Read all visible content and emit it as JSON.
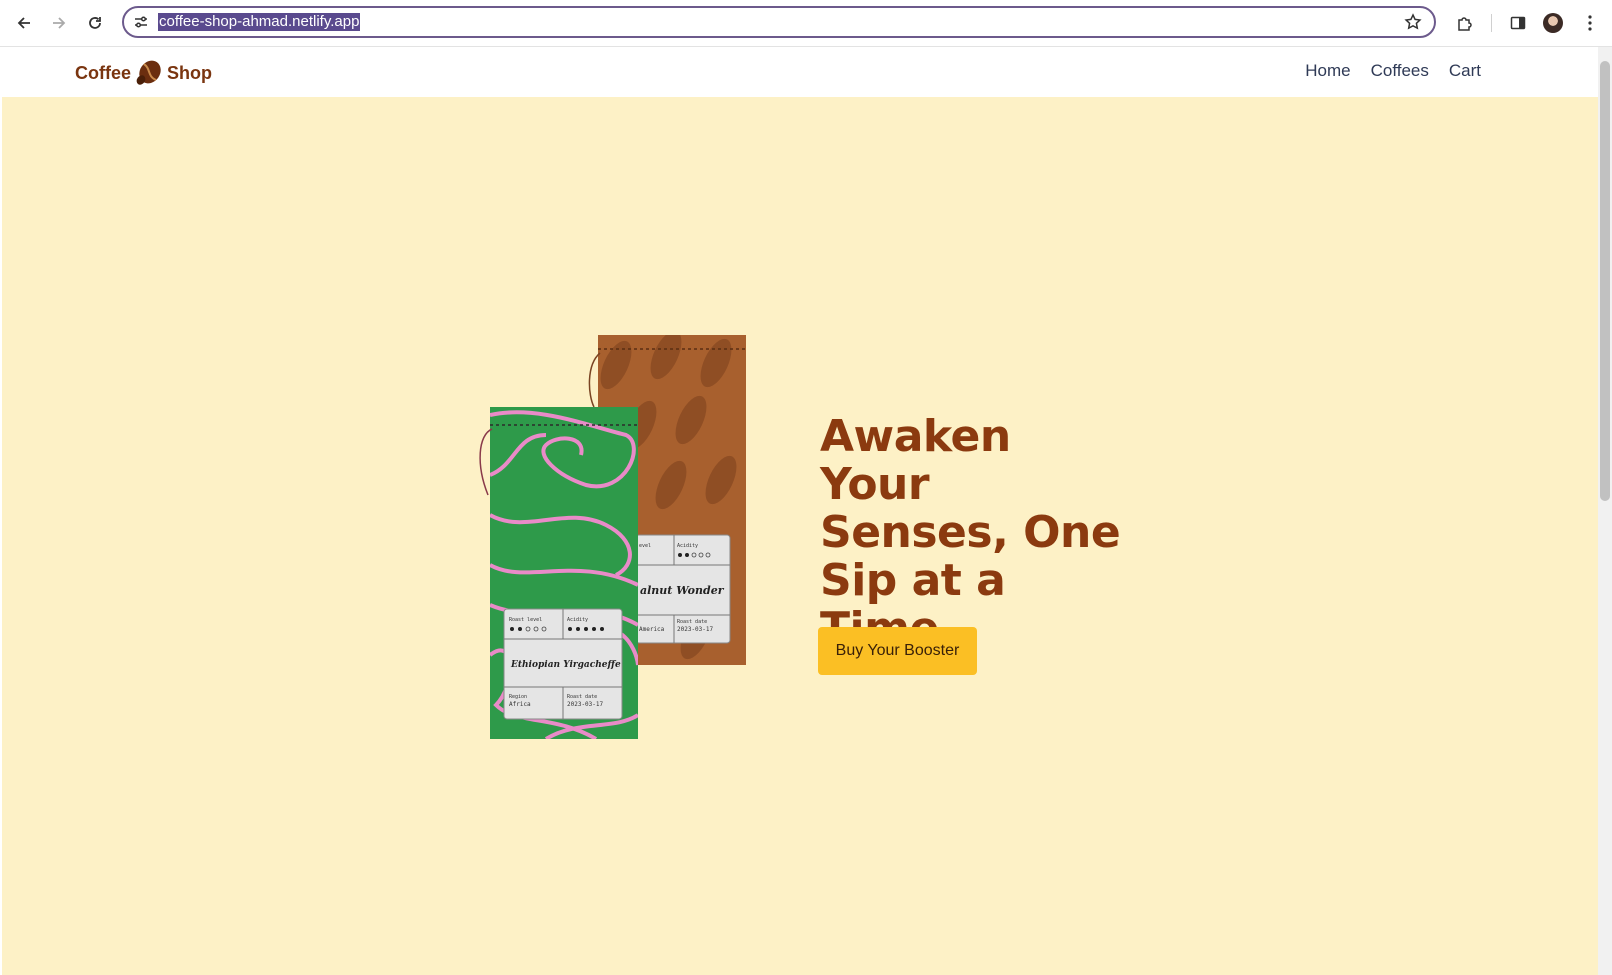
{
  "browser": {
    "url": "coffee-shop-ahmad.netlify.app",
    "icons": {
      "back": "arrow-left-icon",
      "forward": "arrow-right-icon",
      "reload": "reload-icon",
      "site_info": "tune-icon",
      "bookmark": "star-icon",
      "extensions": "puzzle-icon",
      "side_panel": "side-panel-icon",
      "profile": "avatar",
      "menu": "kebab-menu-icon"
    }
  },
  "site": {
    "brand": {
      "left": "Coffee",
      "right": "Shop",
      "logo_icon": "coffee-bean-icon"
    },
    "nav": [
      {
        "label": "Home"
      },
      {
        "label": "Coffees"
      },
      {
        "label": "Cart"
      }
    ],
    "hero": {
      "title": "Awaken Your Senses, One Sip at a Time.",
      "cta_label": "Buy Your Booster",
      "image": {
        "front_bag": {
          "name": "Ethiopian Yirgacheffe",
          "roast_label": "Roast level",
          "acidity_label": "Acidity",
          "region_label": "Region",
          "region": "Africa",
          "date_label": "Roast date",
          "date": "2023-03-17"
        },
        "back_bag": {
          "name": "alnut Wonder",
          "roast_label": "evel",
          "acidity_label": "Acidity",
          "region": "America",
          "date_label": "Roast date",
          "date": "2023-03-17"
        }
      }
    },
    "colors": {
      "background": "#fdf1c6",
      "brand": "#7a3510",
      "title": "#8b3a0f",
      "cta": "#fbbf24",
      "nav_text": "#2f3a56"
    }
  }
}
